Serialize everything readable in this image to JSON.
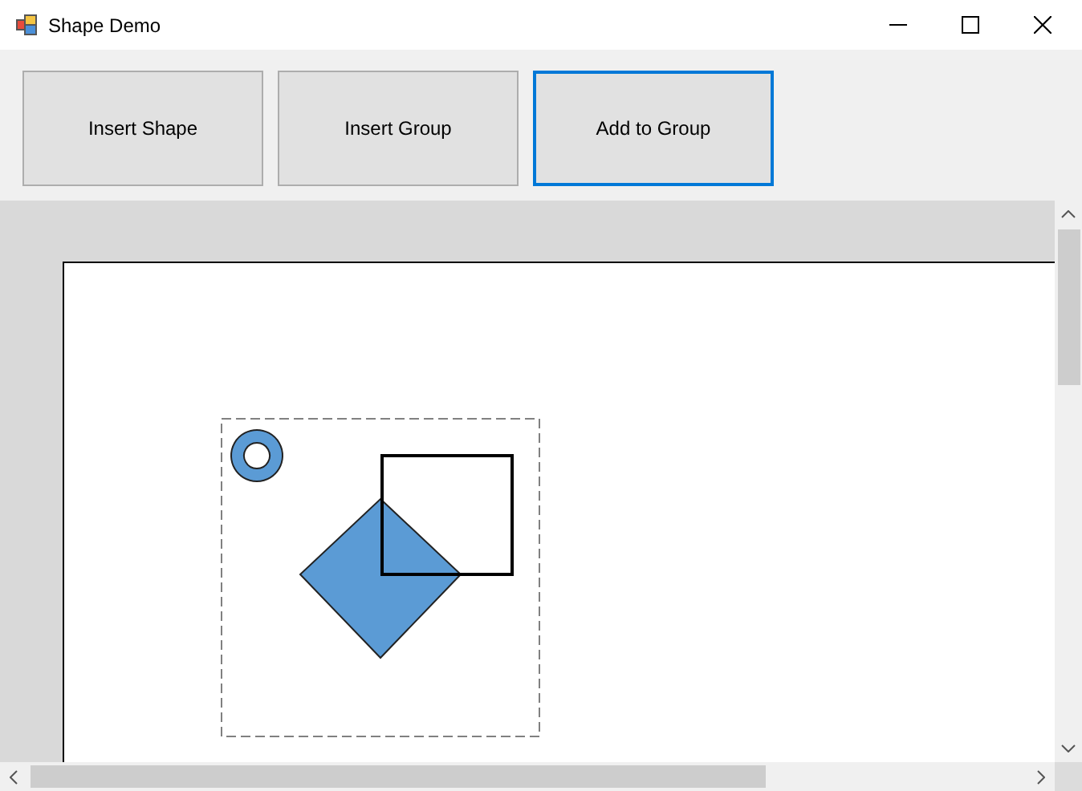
{
  "window": {
    "title": "Shape Demo"
  },
  "buttons": [
    {
      "label": "Insert Shape",
      "focused": false
    },
    {
      "label": "Insert Group",
      "focused": false
    },
    {
      "label": "Add to Group",
      "focused": true
    }
  ]
}
